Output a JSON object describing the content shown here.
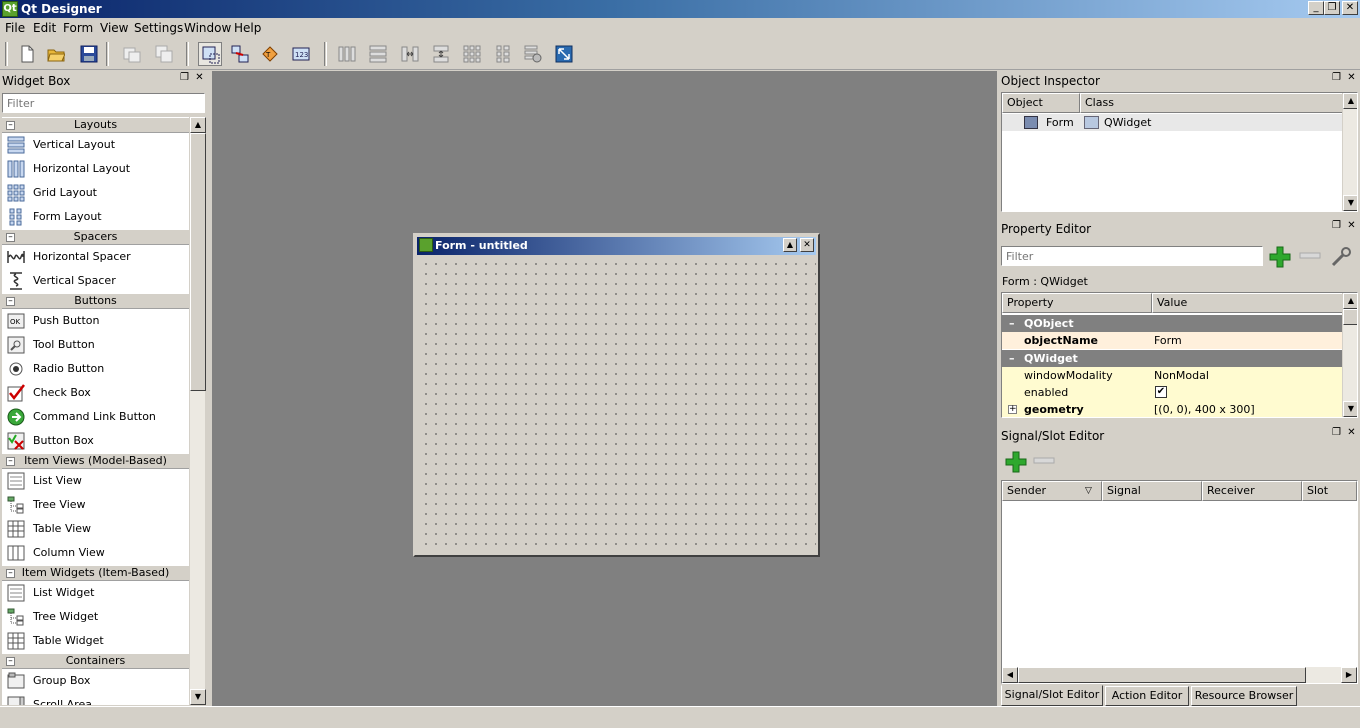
{
  "app": {
    "title": "Qt Designer",
    "icon_letter": "Qt",
    "caption_buttons": [
      "_",
      "❐",
      "✕"
    ]
  },
  "menu": [
    "File",
    "Edit",
    "Form",
    "View",
    "Settings",
    "Window",
    "Help"
  ],
  "toolbar_icons": [
    "new-file-icon",
    "open-folder-icon",
    "save-icon",
    "undo-icon",
    "redo-icon",
    "edit-widgets-icon",
    "edit-signals-slots-icon",
    "edit-buddies-icon",
    "edit-tab-order-icon",
    "lay-out-horizontally-icon",
    "lay-out-vertically-icon",
    "lay-out-horizontal-splitter-icon",
    "lay-out-vertical-splitter-icon",
    "lay-out-grid-icon",
    "lay-out-form-icon",
    "break-layout-icon",
    "adjust-size-icon"
  ],
  "widget_box": {
    "title": "Widget Box",
    "filter_placeholder": "Filter",
    "groups": [
      {
        "name": "Layouts",
        "items": [
          "Vertical Layout",
          "Horizontal Layout",
          "Grid Layout",
          "Form Layout"
        ]
      },
      {
        "name": "Spacers",
        "items": [
          "Horizontal Spacer",
          "Vertical Spacer"
        ]
      },
      {
        "name": "Buttons",
        "items": [
          "Push Button",
          "Tool Button",
          "Radio Button",
          "Check Box",
          "Command Link Button",
          "Button Box"
        ]
      },
      {
        "name": "Item Views (Model-Based)",
        "items": [
          "List View",
          "Tree View",
          "Table View",
          "Column View"
        ]
      },
      {
        "name": "Item Widgets (Item-Based)",
        "items": [
          "List Widget",
          "Tree Widget",
          "Table Widget"
        ]
      },
      {
        "name": "Containers",
        "items": [
          "Group Box",
          "Scroll Area"
        ]
      }
    ]
  },
  "form_window": {
    "title": "Form - untitled"
  },
  "object_inspector": {
    "title": "Object Inspector",
    "columns": [
      "Object",
      "Class"
    ],
    "rows": [
      {
        "object": "Form",
        "class": "QWidget"
      }
    ]
  },
  "property_editor": {
    "title": "Property Editor",
    "filter_placeholder": "Filter",
    "context": "Form : QWidget",
    "columns": [
      "Property",
      "Value"
    ],
    "sections": [
      {
        "name": "QObject",
        "props": [
          {
            "name": "objectName",
            "value": "Form",
            "bold": true
          }
        ]
      },
      {
        "name": "QWidget",
        "props": [
          {
            "name": "windowModality",
            "value": "NonModal",
            "bold": false
          },
          {
            "name": "enabled",
            "value": "✔",
            "bold": false
          },
          {
            "name": "geometry",
            "value": "[(0, 0), 400 x 300]",
            "bold": true
          }
        ]
      }
    ]
  },
  "signal_slot_editor": {
    "title": "Signal/Slot Editor",
    "columns": [
      "Sender",
      "Signal",
      "Receiver",
      "Slot"
    ]
  },
  "bottom_tabs": [
    "Signal/Slot Editor",
    "Action Editor",
    "Resource Browser"
  ],
  "colors": {
    "titlebar_start": "#0a246a",
    "titlebar_end": "#a6caf0",
    "workspace": "#808080",
    "section_header": "#808080",
    "property_row": "#fffbd0",
    "add_green": "#2ea82e"
  }
}
